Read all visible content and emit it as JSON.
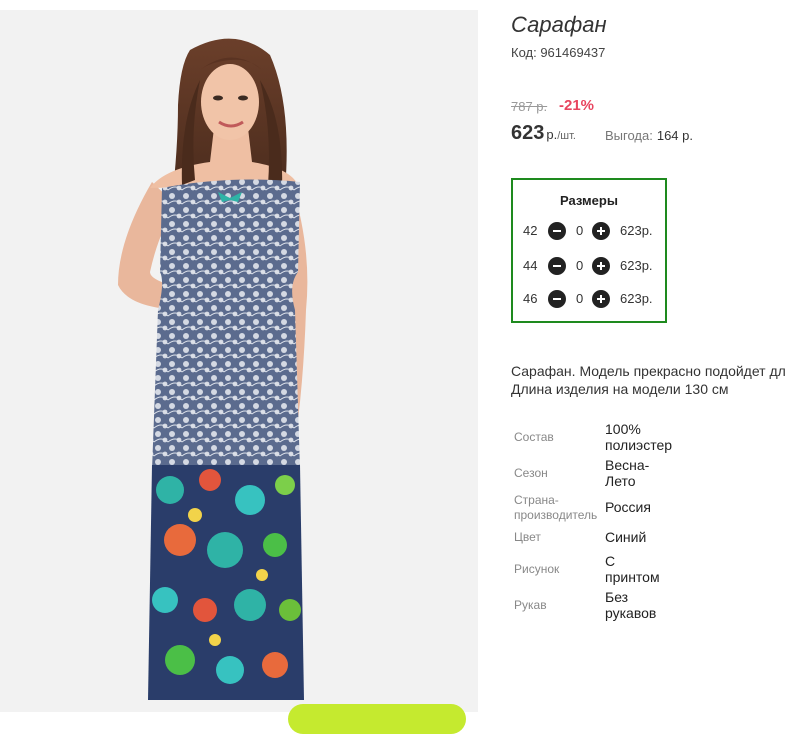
{
  "product": {
    "title": "Сарафан",
    "code_label": "Код: 961469437"
  },
  "pricing": {
    "old_price": "787 р.",
    "discount": "-21%",
    "price": "623",
    "unit": "р.",
    "per_unit": "/шт.",
    "savings_label": "Выгода:",
    "savings_value": "164 р."
  },
  "sizes": {
    "title": "Размеры",
    "rows": [
      {
        "size": "42",
        "qty": "0",
        "price": "623р."
      },
      {
        "size": "44",
        "qty": "0",
        "price": "623р."
      },
      {
        "size": "46",
        "qty": "0",
        "price": "623р."
      }
    ]
  },
  "description": {
    "line1": "Сарафан. Модель прекрасно подойдет дл",
    "line2": "Длина изделия на модели 130 см"
  },
  "specs": [
    {
      "label": "Состав",
      "value_lines": [
        "100%",
        "полиэстер"
      ]
    },
    {
      "label": "Сезон",
      "value_lines": [
        "Весна-",
        "Лето"
      ]
    },
    {
      "label_lines": [
        "Страна-",
        "производитель"
      ],
      "value": "Россия"
    },
    {
      "label": "Цвет",
      "value": "Синий"
    },
    {
      "label": "Рисунок",
      "value_lines": [
        "С",
        "принтом"
      ]
    },
    {
      "label": "Рукав",
      "value_lines": [
        "Без",
        "рукавов"
      ]
    }
  ],
  "colors": {
    "accent_green_border": "#1e8a1e",
    "discount_red": "#e8455f",
    "cta_green": "#c5ea2f",
    "dress_blue": "#5b6b8e",
    "floral_teal": "#2fb3a6"
  },
  "icons": [
    "minus-circle-icon",
    "plus-circle-icon"
  ]
}
